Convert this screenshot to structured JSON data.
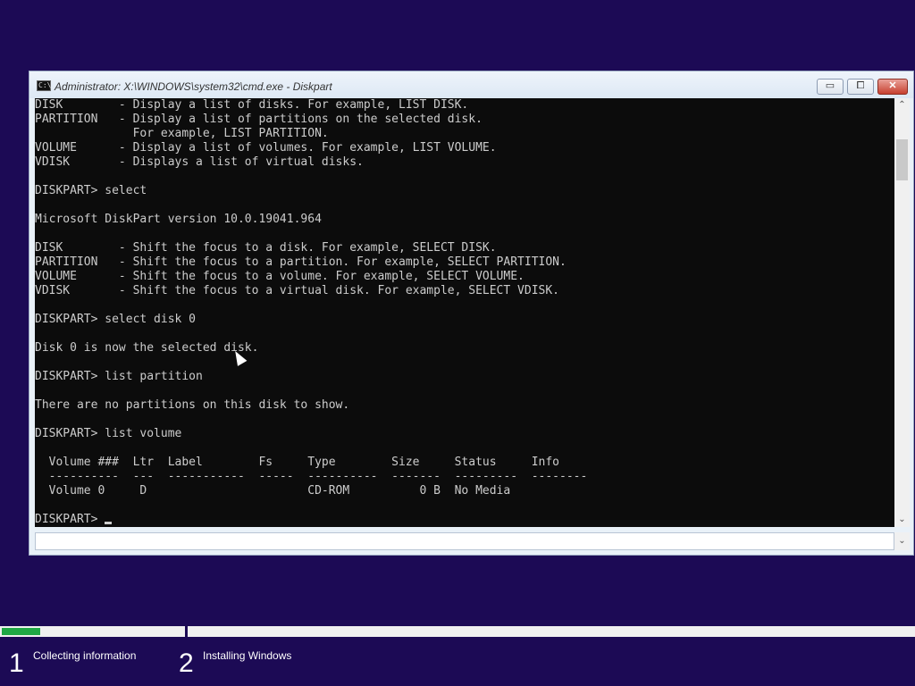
{
  "window": {
    "title": "Administrator: X:\\WINDOWS\\system32\\cmd.exe - Diskpart",
    "icon_text": "C:\\",
    "min_label": "▭",
    "max_label": "⧠",
    "close_label": "✕"
  },
  "console": {
    "lines": [
      "DISK        - Display a list of disks. For example, LIST DISK.",
      "PARTITION   - Display a list of partitions on the selected disk.",
      "              For example, LIST PARTITION.",
      "VOLUME      - Display a list of volumes. For example, LIST VOLUME.",
      "VDISK       - Displays a list of virtual disks.",
      "",
      "DISKPART> select",
      "",
      "Microsoft DiskPart version 10.0.19041.964",
      "",
      "DISK        - Shift the focus to a disk. For example, SELECT DISK.",
      "PARTITION   - Shift the focus to a partition. For example, SELECT PARTITION.",
      "VOLUME      - Shift the focus to a volume. For example, SELECT VOLUME.",
      "VDISK       - Shift the focus to a virtual disk. For example, SELECT VDISK.",
      "",
      "DISKPART> select disk 0",
      "",
      "Disk 0 is now the selected disk.",
      "",
      "DISKPART> list partition",
      "",
      "There are no partitions on this disk to show.",
      "",
      "DISKPART> list volume",
      "",
      "  Volume ###  Ltr  Label        Fs     Type        Size     Status     Info",
      "  ----------  ---  -----------  -----  ----------  -------  ---------  --------",
      "  Volume 0     D                       CD-ROM          0 B  No Media",
      ""
    ],
    "prompt": "DISKPART> "
  },
  "scrollbar": {
    "up_icon": "up-arrow",
    "down_icon": "down-arrow",
    "up_glyph": "⌃",
    "down_glyph": "⌄"
  },
  "inputbar": {
    "dropdown_glyph": "⌄"
  },
  "setup": {
    "progress_fraction": 0.21,
    "progress_color": "#1fa844",
    "steps": [
      {
        "number": "1",
        "label": "Collecting information"
      },
      {
        "number": "2",
        "label": "Installing Windows"
      }
    ]
  },
  "colors": {
    "desktop": "#1c0a55",
    "console_bg": "#0c0c0c",
    "console_fg": "#cccccc"
  }
}
